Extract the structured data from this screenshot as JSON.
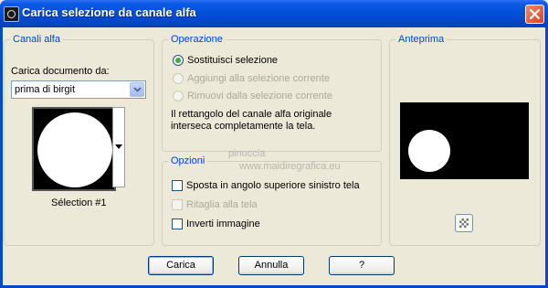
{
  "window": {
    "title": "Carica selezione da canale alfa"
  },
  "groups": {
    "canali": "Canali alfa",
    "operazione": "Operazione",
    "opzioni": "Opzioni",
    "anteprima": "Anteprima"
  },
  "canali": {
    "load_label": "Carica documento da:",
    "document_value": "prima di birgit",
    "selection_label": "Sélection #1"
  },
  "operazione": {
    "options": [
      {
        "label": "Sostituisci selezione",
        "selected": true,
        "enabled": true
      },
      {
        "label": "Aggiungi alla selezione corrente",
        "selected": false,
        "enabled": false
      },
      {
        "label": "Rimuovi dalla selezione corrente",
        "selected": false,
        "enabled": false
      }
    ],
    "info_line1": "Il rettangolo del canale alfa originale",
    "info_line2": "interseca completamente la tela."
  },
  "opzioni": {
    "items": [
      {
        "label": "Sposta in angolo superiore sinistro tela",
        "checked": false,
        "enabled": true
      },
      {
        "label": "Ritaglia alla tela",
        "checked": false,
        "enabled": false
      },
      {
        "label": "Inverti immagine",
        "checked": false,
        "enabled": true
      }
    ]
  },
  "buttons": {
    "ok": "Carica",
    "cancel": "Annulla",
    "help": "?"
  },
  "watermark": {
    "line1": "pinuccia",
    "line2": "www.maidiregrafica.eu"
  },
  "colors": {
    "title_bar": "#0450D8",
    "group_label": "#0046D5",
    "radio_selected": "#3DAF3D",
    "dialog_bg": "#ECE9D8"
  }
}
